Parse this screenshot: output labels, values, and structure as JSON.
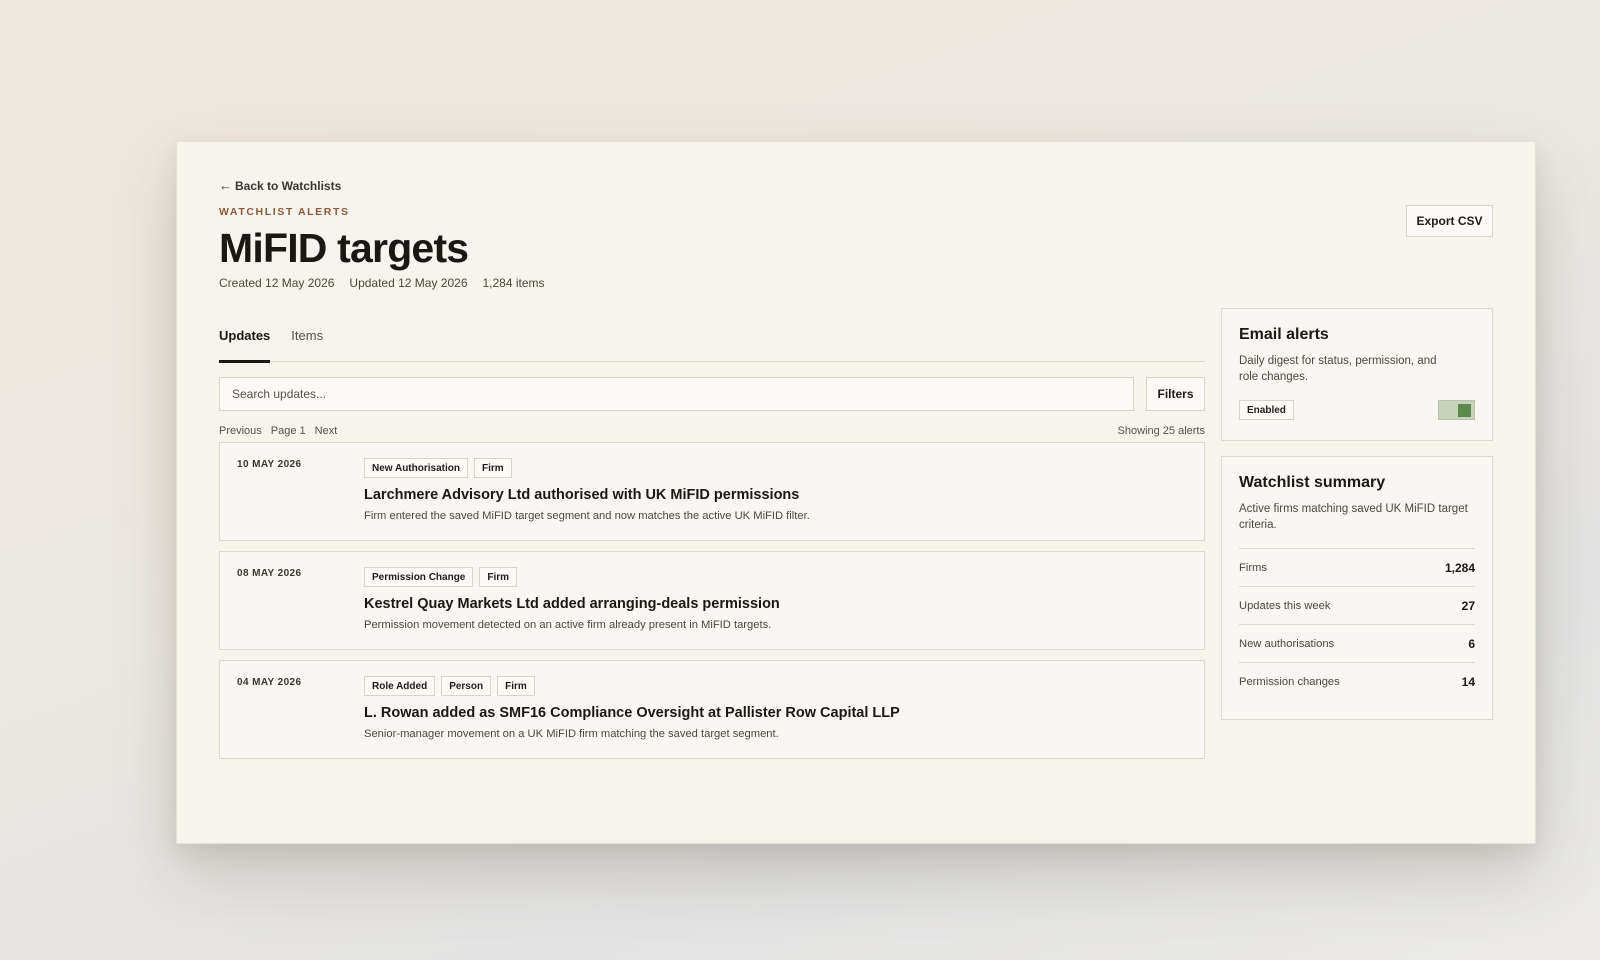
{
  "nav": {
    "back_label": "Back to Watchlists",
    "back_icon": "arrow-left-icon"
  },
  "header": {
    "eyebrow": "WATCHLIST ALERTS",
    "title": "MiFID targets",
    "created": "Created 12 May 2026",
    "updated": "Updated 12 May 2026",
    "item_count": "1,284 items",
    "export_label": "Export CSV"
  },
  "tabs": [
    {
      "label": "Updates",
      "active": true
    },
    {
      "label": "Items",
      "active": false
    }
  ],
  "search": {
    "placeholder": "Search updates...",
    "value": ""
  },
  "filters_label": "Filters",
  "pager": {
    "previous": "Previous",
    "page": "Page 1",
    "next": "Next",
    "showing": "Showing 25 alerts"
  },
  "alerts": [
    {
      "date": "10 MAY 2026",
      "tags": [
        "New Authorisation",
        "Firm"
      ],
      "title": "Larchmere Advisory Ltd authorised with UK MiFID permissions",
      "description": "Firm entered the saved MiFID target segment and now matches the active UK MiFID filter."
    },
    {
      "date": "08 MAY 2026",
      "tags": [
        "Permission Change",
        "Firm"
      ],
      "title": "Kestrel Quay Markets Ltd added arranging-deals permission",
      "description": "Permission movement detected on an active firm already present in MiFID targets."
    },
    {
      "date": "04 MAY 2026",
      "tags": [
        "Role Added",
        "Person",
        "Firm"
      ],
      "title": "L. Rowan added as SMF16 Compliance Oversight at Pallister Row Capital LLP",
      "description": "Senior-manager movement on a UK MiFID firm matching the saved target segment."
    }
  ],
  "email_alerts": {
    "title": "Email alerts",
    "description": "Daily digest for status, permission, and role changes.",
    "status": "Enabled",
    "enabled": true,
    "toggle_color": "#5c8a4e"
  },
  "summary": {
    "title": "Watchlist summary",
    "description": "Active firms matching saved UK MiFID target criteria.",
    "stats": [
      {
        "label": "Firms",
        "value": "1,284"
      },
      {
        "label": "Updates this week",
        "value": "27"
      },
      {
        "label": "New authorisations",
        "value": "6"
      },
      {
        "label": "Permission changes",
        "value": "14"
      }
    ]
  },
  "colors": {
    "eyebrow": "#8a5a3a",
    "background": "#f7f4ee",
    "text": "#1b1814"
  }
}
